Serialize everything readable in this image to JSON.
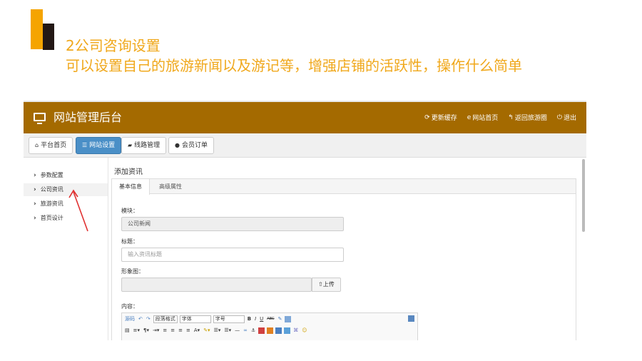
{
  "slide": {
    "heading": "2公司咨询设置",
    "subheading": "可以设置自己的旅游新闻以及游记等，增强店铺的活跃性，操作什么简单",
    "accent_color": "#f0a81c"
  },
  "app": {
    "title": "网站管理后台",
    "topbar_color": "#a46a00",
    "top_links": [
      {
        "icon": "refresh-icon",
        "label": "更新缓存"
      },
      {
        "icon": "ie-icon",
        "label": "网站首页"
      },
      {
        "icon": "reply-icon",
        "label": "返回旅游圈"
      },
      {
        "icon": "logout-icon",
        "label": "退出"
      }
    ],
    "nav_tabs": [
      {
        "icon": "home-icon",
        "label": "平台首页"
      },
      {
        "icon": "list-icon",
        "label": "网站设置",
        "active": true
      },
      {
        "icon": "folder-icon",
        "label": "线路管理"
      },
      {
        "icon": "user-icon",
        "label": "会员订单"
      }
    ],
    "sidebar": [
      {
        "icon": "chevron-right-icon",
        "label": "参数配置"
      },
      {
        "icon": "chevron-right-icon",
        "label": "公司资讯",
        "selected": true
      },
      {
        "icon": "chevron-right-icon",
        "label": "旅游资讯"
      },
      {
        "icon": "chevron-right-icon",
        "label": "首页设计"
      }
    ]
  },
  "form": {
    "title": "添加资讯",
    "tabs": [
      "基本信息",
      "高级属性"
    ],
    "module_label": "模块：",
    "module_value": "公司新闻",
    "title_label": "标题：",
    "title_placeholder": "输入资讯标题",
    "image_label": "形象图：",
    "upload_label": "上传",
    "content_label": "内容："
  },
  "editor": {
    "row1": [
      "源码",
      "撤销",
      "重做",
      "段落格式",
      "字体",
      "字号",
      "B",
      "I",
      "U",
      "ABC"
    ],
    "row2": [
      "A",
      "•",
      "•"
    ]
  }
}
